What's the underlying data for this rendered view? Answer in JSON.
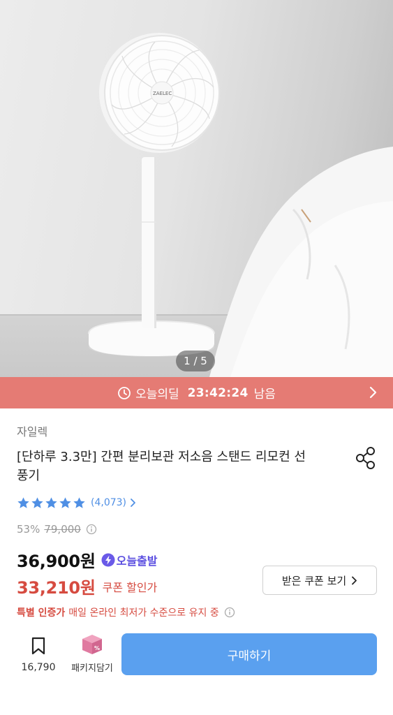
{
  "gallery": {
    "counter": "1 / 5",
    "brand_mark": "ZAELEC"
  },
  "deal_bar": {
    "label": "오늘의딜",
    "time": "23:42:24",
    "suffix": "남음"
  },
  "product": {
    "brand": "자일렉",
    "title": "[단하루 3.3만] 간편 분리보관 저소음 스탠드 리모컨 선풍기",
    "rating": {
      "stars": 5,
      "review_count": "(4,073)"
    },
    "discount": "53%",
    "original_price": "79,000",
    "price": "36,900원",
    "today_badge": "오늘출발",
    "coupon_price": "33,210원",
    "coupon_label": "쿠폰 할인가",
    "coupon_button": "받은 쿠폰 보기",
    "cert_strong": "특별 인증가",
    "cert_text": "매일 온라인 최저가 수준으로 유지 중"
  },
  "bottom_bar": {
    "wishlist_count": "16,790",
    "package_label": "패키지담기",
    "buy_label": "구매하기"
  },
  "colors": {
    "deal_bar": "#e57b74",
    "sale_red": "#d64b40",
    "buy_blue": "#5aa0ef",
    "star_blue": "#4f8fe4",
    "badge_purple": "#5b4ee0",
    "package_pink": "#e07aa0"
  }
}
